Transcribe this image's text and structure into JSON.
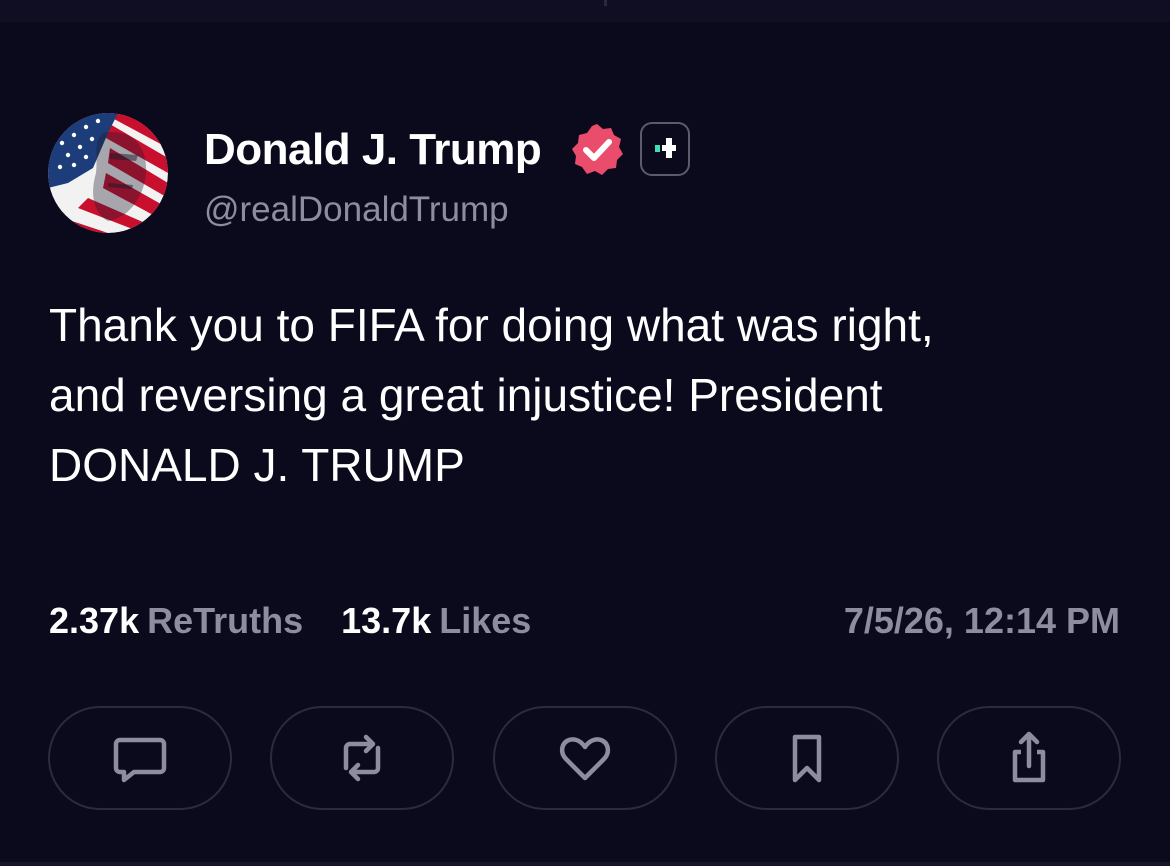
{
  "post": {
    "author": {
      "display_name": "Donald J. Trump",
      "handle": "@realDonaldTrump",
      "avatar_icon": "flag-portrait-avatar",
      "verified_icon": "verified-badge-icon",
      "plus_icon": "plus-badge-icon"
    },
    "text": "Thank you to FIFA for doing what was right,\nand reversing a great injustice! President\nDONALD J. TRUMP",
    "stats": {
      "retruths_count": "2.37k",
      "retruths_label": "ReTruths",
      "likes_count": "13.7k",
      "likes_label": "Likes"
    },
    "timestamp": "7/5/26, 12:14 PM"
  },
  "actions": [
    {
      "name": "reply",
      "icon": "comment-icon"
    },
    {
      "name": "retruth",
      "icon": "repost-icon"
    },
    {
      "name": "like",
      "icon": "heart-icon"
    },
    {
      "name": "bookmark",
      "icon": "bookmark-icon"
    },
    {
      "name": "share",
      "icon": "share-icon"
    }
  ],
  "colors": {
    "background": "#0b0a1c",
    "text_primary": "#ffffff",
    "text_secondary": "#8e8d9f",
    "verified_badge": "#ea4c6c",
    "plus_accent": "#3fe0b8",
    "button_border": "#2a2a40"
  }
}
